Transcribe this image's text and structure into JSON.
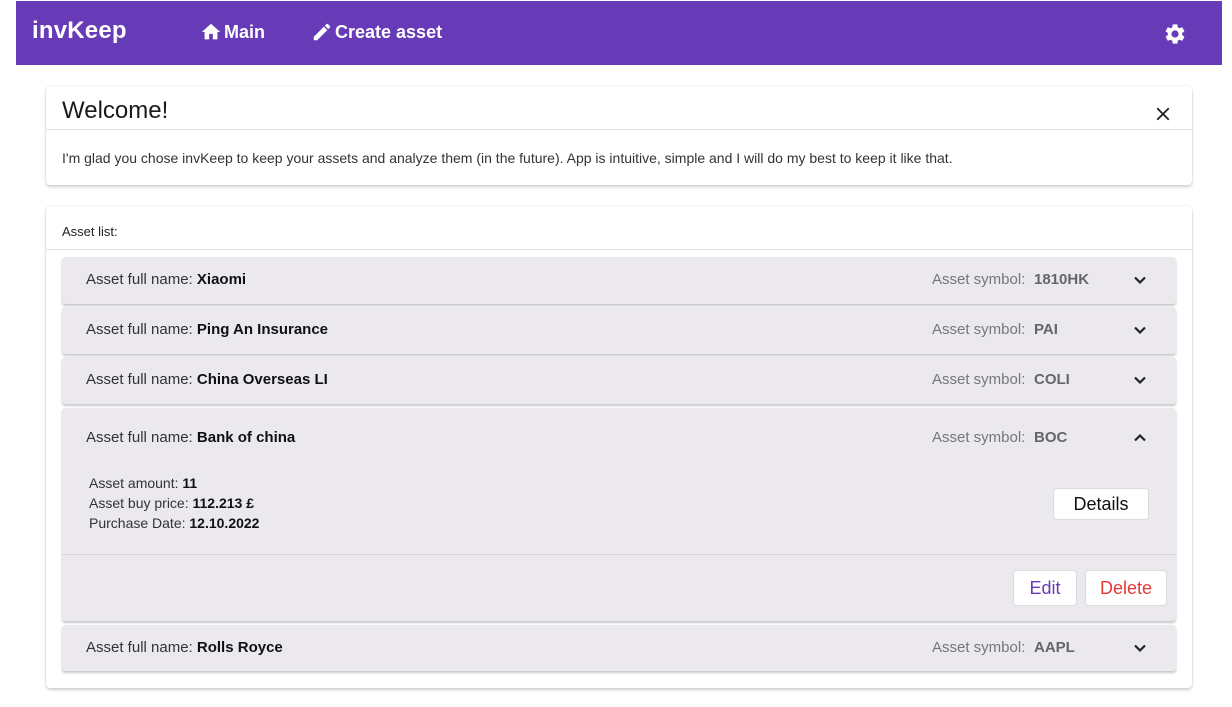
{
  "app": {
    "brand": "invKeep",
    "nav": {
      "main_label": "Main",
      "create_label": "Create asset"
    },
    "accent_color": "#673ab7"
  },
  "welcome": {
    "title": "Welcome!",
    "text": "I'm glad you chose invKeep to keep your assets and analyze them (in the future). App is intuitive, simple and I will do my best to keep it like that."
  },
  "asset_list": {
    "label": "Asset list:",
    "name_label": "Asset full name:",
    "symbol_label": "Asset symbol:",
    "items": [
      {
        "name": "Xiaomi",
        "symbol": "1810HK",
        "expanded": false
      },
      {
        "name": "Ping An Insurance",
        "symbol": "PAI",
        "expanded": false
      },
      {
        "name": "China Overseas LI",
        "symbol": "COLI",
        "expanded": false
      },
      {
        "name": "Bank of china",
        "symbol": "BOC",
        "expanded": true,
        "amount_label": "Asset amount:",
        "amount": "11",
        "price_label": "Asset buy price:",
        "price": "112.213 £",
        "date_label": "Purchase Date:",
        "date": "12.10.2022",
        "details_label": "Details",
        "edit_label": "Edit",
        "delete_label": "Delete"
      },
      {
        "name": "Rolls Royce",
        "symbol": "AAPL",
        "expanded": false
      }
    ]
  },
  "icons": {
    "home": "home-icon",
    "edit": "pencil-icon",
    "settings": "gear-icon",
    "close": "close-icon",
    "expand": "chevron-down-icon",
    "collapse": "chevron-up-icon"
  }
}
